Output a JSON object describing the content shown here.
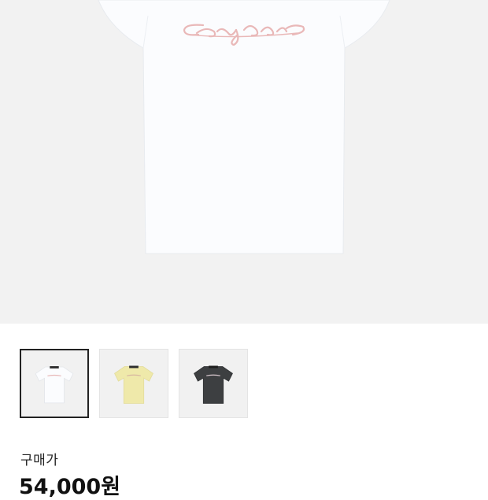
{
  "product": {
    "main_image": {
      "name": "white-tshirt-front",
      "colors": {
        "shirt": "#fbfcfe",
        "print": "#e9b8b8",
        "background": "#f2f2f2"
      }
    },
    "thumbnails": [
      {
        "name": "white-tshirt-thumb",
        "color": "#fbfcfe",
        "print": "#e7b7b7",
        "selected": true
      },
      {
        "name": "yellow-tshirt-thumb",
        "color": "#efe9aa",
        "print": "#d7b7a0",
        "selected": false
      },
      {
        "name": "charcoal-tshirt-thumb",
        "color": "#3d3f41",
        "print": "#d9c9cf",
        "selected": false
      }
    ]
  },
  "price": {
    "label": "구매가",
    "value": "54,000원"
  }
}
